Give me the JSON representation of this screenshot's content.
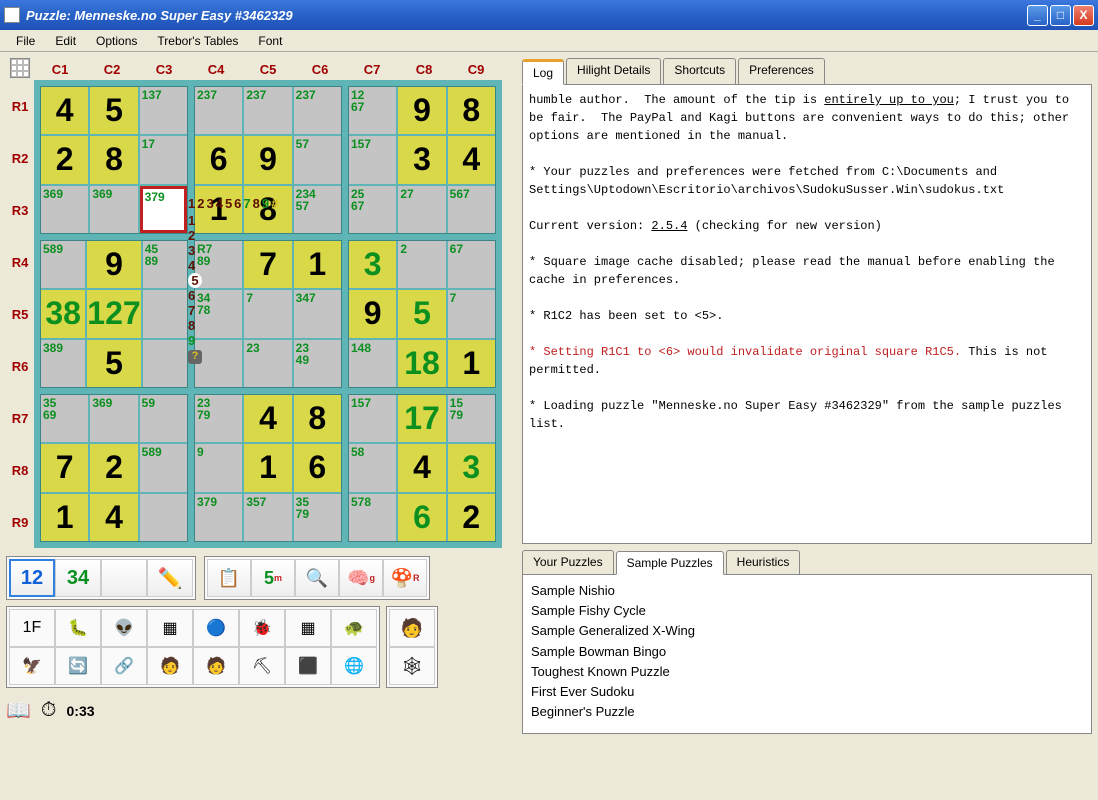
{
  "title": "Puzzle: Menneske.no Super Easy #3462329",
  "menu": [
    "File",
    "Edit",
    "Options",
    "Trebor's Tables",
    "Font"
  ],
  "cols": [
    "C1",
    "C2",
    "C3",
    "C4",
    "C5",
    "C6",
    "C7",
    "C8",
    "C9"
  ],
  "rows": [
    "R1",
    "R2",
    "R3",
    "R4",
    "R5",
    "R6",
    "R7",
    "R8",
    "R9"
  ],
  "cells": [
    [
      {
        "t": "s",
        "v": "4"
      },
      {
        "t": "s",
        "v": "5"
      },
      {
        "t": "c",
        "v": "137"
      },
      {
        "t": "c",
        "v": "237"
      },
      {
        "t": "c",
        "v": "237"
      },
      {
        "t": "c",
        "v": "237"
      },
      {
        "t": "c",
        "v": "12\n67"
      },
      {
        "t": "s",
        "v": "9"
      },
      {
        "t": "s",
        "v": "8"
      }
    ],
    [
      {
        "t": "s",
        "v": "2"
      },
      {
        "t": "s",
        "v": "8"
      },
      {
        "t": "c",
        "v": "17"
      },
      {
        "t": "s",
        "v": "6"
      },
      {
        "t": "s",
        "v": "9"
      },
      {
        "t": "c",
        "v": "57"
      },
      {
        "t": "c",
        "v": "157"
      },
      {
        "t": "s",
        "v": "3"
      },
      {
        "t": "s",
        "v": "4"
      }
    ],
    [
      {
        "t": "c",
        "v": "369"
      },
      {
        "t": "c",
        "v": "369"
      },
      {
        "t": "sel",
        "v": "379"
      },
      {
        "t": "s",
        "v": "1"
      },
      {
        "t": "s",
        "v": "8"
      },
      {
        "t": "c",
        "v": "234\n57"
      },
      {
        "t": "c",
        "v": "25\n67"
      },
      {
        "t": "c",
        "v": "27"
      },
      {
        "t": "c",
        "v": "567"
      }
    ],
    [
      {
        "t": "c",
        "v": "589"
      },
      {
        "t": "s",
        "v": "9"
      },
      {
        "t": "c",
        "v": "45\n89"
      },
      {
        "t": "c",
        "v": "R7\n89"
      },
      {
        "t": "s",
        "v": "7"
      },
      {
        "t": "s",
        "v": "1"
      },
      {
        "t": "g",
        "v": "3"
      },
      {
        "t": "c",
        "v": "2"
      },
      {
        "t": "c",
        "v": "67"
      }
    ],
    [
      {
        "t": "g",
        "v": "38"
      },
      {
        "t": "g",
        "v": "127"
      },
      {
        "t": "c",
        "v": ""
      },
      {
        "t": "c",
        "v": "34\n78"
      },
      {
        "t": "c",
        "v": "7"
      },
      {
        "t": "c",
        "v": "347"
      },
      {
        "t": "s",
        "v": "9"
      },
      {
        "t": "g",
        "v": "5"
      },
      {
        "t": "c",
        "v": "7"
      }
    ],
    [
      {
        "t": "c",
        "v": "389"
      },
      {
        "t": "s",
        "v": "5"
      },
      {
        "t": "c",
        "v": ""
      },
      {
        "t": "c",
        "v": ""
      },
      {
        "t": "c",
        "v": "23"
      },
      {
        "t": "c",
        "v": "23\n49"
      },
      {
        "t": "c",
        "v": "148"
      },
      {
        "t": "g",
        "v": "18"
      },
      {
        "t": "s",
        "v": "1"
      }
    ],
    [
      {
        "t": "c",
        "v": "35\n69"
      },
      {
        "t": "c",
        "v": "369"
      },
      {
        "t": "c",
        "v": "59"
      },
      {
        "t": "c",
        "v": "23\n79"
      },
      {
        "t": "s",
        "v": "4"
      },
      {
        "t": "s",
        "v": "8"
      },
      {
        "t": "c",
        "v": "157"
      },
      {
        "t": "g",
        "v": "17"
      },
      {
        "t": "c",
        "v": "15\n79"
      }
    ],
    [
      {
        "t": "s",
        "v": "7"
      },
      {
        "t": "s",
        "v": "2"
      },
      {
        "t": "c",
        "v": "589"
      },
      {
        "t": "c",
        "v": "9"
      },
      {
        "t": "s",
        "v": "1"
      },
      {
        "t": "s",
        "v": "6"
      },
      {
        "t": "c",
        "v": "58"
      },
      {
        "t": "s",
        "v": "4"
      },
      {
        "t": "g",
        "v": "3"
      }
    ],
    [
      {
        "t": "s",
        "v": "1"
      },
      {
        "t": "s",
        "v": "4"
      },
      {
        "t": "c",
        "v": ""
      },
      {
        "t": "c",
        "v": "379"
      },
      {
        "t": "c",
        "v": "357"
      },
      {
        "t": "c",
        "v": "35\n79"
      },
      {
        "t": "c",
        "v": "578"
      },
      {
        "t": "g",
        "v": "6"
      },
      {
        "t": "s",
        "v": "2"
      }
    ]
  ],
  "hint_nums": [
    "1",
    "2",
    "3",
    "4",
    "5",
    "6",
    "7",
    "8",
    "9",
    "#"
  ],
  "tabs_top": [
    "Log",
    "Hilight Details",
    "Shortcuts",
    "Preferences"
  ],
  "log_text_1": "humble author.  The amount of the tip is ",
  "log_text_2": "entirely up to you",
  "log_text_3": "; I trust you to be fair.  The PayPal and Kagi buttons are convenient ways to do this; other options are mentioned in the manual.\n\n* Your puzzles and preferences were fetched from C:\\Documents and Settings\\Uptodown\\Escritorio\\archivos\\SudokuSusser.Win\\sudokus.txt\n\nCurrent version: ",
  "log_version": "2.5.4",
  "log_text_4": " (checking for new version)\n\n* Square image cache disabled; please read the manual before enabling the cache in preferences.\n\n* R1C2 has been set to <5>.\n\n",
  "log_err": "* Setting R1C1 to <6> would invalidate original square R1C5.",
  "log_text_5": " This is not permitted.\n\n* Loading puzzle \"Menneske.no Super Easy #3462329\" from the sample puzzles list.",
  "tabs_bottom": [
    "Your Puzzles",
    "Sample Puzzles",
    "Heuristics"
  ],
  "puzzles": [
    "Sample Nishio",
    "Sample Fishy Cycle",
    "Sample Generalized X-Wing",
    "Sample Bowman Bingo",
    "Toughest Known Puzzle",
    "First Ever Sudoku",
    "Beginner's Puzzle"
  ],
  "timer": "0:33",
  "toolbar1": {
    "t12": "12",
    "t34": "34",
    "t5": "5",
    "tg": "g",
    "tr": "R"
  },
  "icons": [
    "1F",
    "🐛",
    "👽",
    "▦",
    "🔵",
    "🐞",
    "▦",
    "🐢",
    "🦅",
    "🔄",
    "🔗",
    "🧑",
    "🧑",
    "⛏",
    "⬛",
    "🌐",
    "🧑",
    "🕸"
  ]
}
